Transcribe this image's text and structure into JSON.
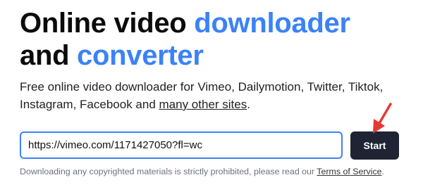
{
  "hero": {
    "title_part1": "Online video ",
    "title_accent1": "downloader",
    "title_part2": "and ",
    "title_accent2": "converter"
  },
  "description": {
    "text": "Free online video downloader for Vimeo, Dailymotion, Twitter, Tiktok, Instagram, Facebook and ",
    "link_label": "many other sites",
    "suffix": "."
  },
  "form": {
    "url_value": "https://vimeo.com/1171427050?fl=wc",
    "start_label": "Start"
  },
  "disclaimer": {
    "text": "Downloading any copyrighted materials is strictly prohibited, please read our ",
    "link_label": "Terms of Service",
    "suffix": "."
  },
  "colors": {
    "accent": "#3b82f6",
    "button_bg": "#1e2433",
    "annotation_arrow": "#e53935"
  },
  "icons": {
    "annotation": "red-arrow-icon"
  }
}
